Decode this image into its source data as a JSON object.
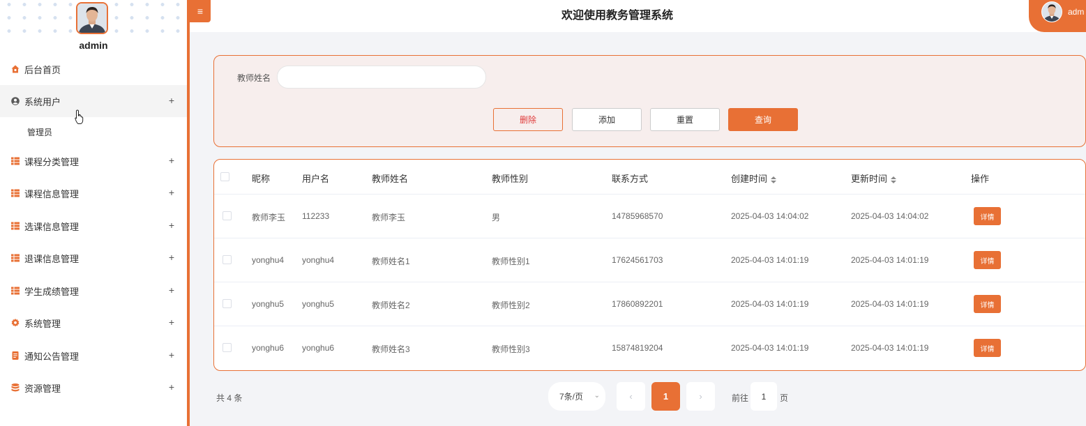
{
  "app": {
    "title": "欢迎使用教务管理系统"
  },
  "user": {
    "name": "admin",
    "chip_name": "adm"
  },
  "header": {
    "menu_toggle": "≡"
  },
  "sidebar": {
    "items": [
      {
        "label": "后台首页",
        "icon": "home-icon"
      },
      {
        "label": "系统用户",
        "icon": "user-icon",
        "expander": "+"
      },
      {
        "label": "管理员"
      },
      {
        "label": "课程分类管理",
        "icon": "grid-icon",
        "expander": "+"
      },
      {
        "label": "课程信息管理",
        "icon": "grid-icon",
        "expander": "+"
      },
      {
        "label": "选课信息管理",
        "icon": "grid-icon",
        "expander": "+"
      },
      {
        "label": "退课信息管理",
        "icon": "grid-icon",
        "expander": "+"
      },
      {
        "label": "学生成绩管理",
        "icon": "grid-icon",
        "expander": "+"
      },
      {
        "label": "系统管理",
        "icon": "gear-icon",
        "expander": "+"
      },
      {
        "label": "通知公告管理",
        "icon": "document-icon",
        "expander": "+"
      },
      {
        "label": "资源管理",
        "icon": "database-icon",
        "expander": "+"
      }
    ]
  },
  "search": {
    "label": "教师姓名",
    "value": "",
    "placeholder": "",
    "delete_label": "删除",
    "add_label": "添加",
    "reset_label": "重置",
    "query_label": "查询"
  },
  "table": {
    "columns": [
      "昵称",
      "用户名",
      "教师姓名",
      "教师性别",
      "联系方式",
      "创建时间",
      "更新时间",
      "操作"
    ],
    "rows": [
      {
        "nickname": "教师李玉",
        "username": "112233",
        "teacher_name": "教师李玉",
        "gender": "男",
        "phone": "14785968570",
        "created": "2025-04-03 14:04:02",
        "updated": "2025-04-03 14:04:02",
        "action": "详情"
      },
      {
        "nickname": "yonghu4",
        "username": "yonghu4",
        "teacher_name": "教师姓名1",
        "gender": "教师性别1",
        "phone": "17624561703",
        "created": "2025-04-03 14:01:19",
        "updated": "2025-04-03 14:01:19",
        "action": "详情"
      },
      {
        "nickname": "yonghu5",
        "username": "yonghu5",
        "teacher_name": "教师姓名2",
        "gender": "教师性别2",
        "phone": "17860892201",
        "created": "2025-04-03 14:01:19",
        "updated": "2025-04-03 14:01:19",
        "action": "详情"
      },
      {
        "nickname": "yonghu6",
        "username": "yonghu6",
        "teacher_name": "教师姓名3",
        "gender": "教师性别3",
        "phone": "15874819204",
        "created": "2025-04-03 14:01:19",
        "updated": "2025-04-03 14:01:19",
        "action": "详情"
      }
    ]
  },
  "pagination": {
    "total": "共 4 条",
    "page_size": "7条/页",
    "prev": "‹",
    "current": "1",
    "next": "›",
    "goto_prefix": "前往",
    "goto_value": "1",
    "goto_suffix": "页"
  },
  "colors": {
    "accent": "#e87035",
    "panel_bg": "#f7eeed",
    "danger_text": "#e03c3c"
  }
}
